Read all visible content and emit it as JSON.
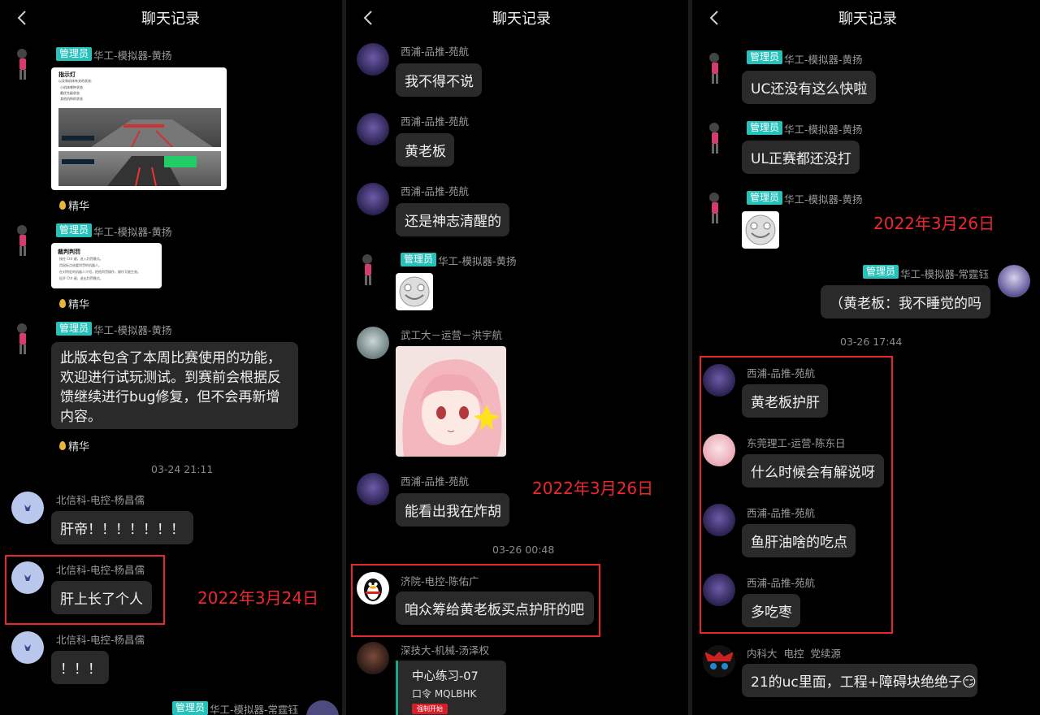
{
  "title": "聊天记录",
  "colors": {
    "admin_tag": "#26c1b9",
    "annotation_red": "#f0262e",
    "bubble": "#2a2a2a"
  },
  "panel1": {
    "m1": {
      "badge": "管理员",
      "name": "华工-模拟器-黄扬",
      "card_title": "指示灯",
      "card_sub": "以及和机体有关的状态:",
      "card_items": [
        "小机体哪种状态",
        "最优先级状态",
        "其他机构的状态"
      ],
      "tag": "精华"
    },
    "m2": {
      "badge": "管理员",
      "name": "华工-模拟器-黄扬",
      "card_title": "裁判判罚",
      "card_items": [
        "按住 Ctrl 键，进入判罚模式。",
        "用鼠标点选要判罚的机器人。",
        "在对特定的机器人介绍，把他判罚操作，操作又能生效。",
        "松开 Ctrl 键，退出判罚模式。"
      ],
      "tag": "精华"
    },
    "m3": {
      "badge": "管理员",
      "name": "华工-模拟器-黄扬",
      "text": "此版本包含了本周比赛使用的功能，欢迎进行试玩测试。到赛前会根据反馈继续进行bug修复，但不会再新增内容。",
      "tag": "精华"
    },
    "ts": "03-24 21:11",
    "m4": {
      "name": "北信科-电控-杨昌儒",
      "text": "肝帝！！！！！！！"
    },
    "m5": {
      "name": "北信科-电控-杨昌儒",
      "text": "肝上长了个人"
    },
    "m6": {
      "name": "北信科-电控-杨昌儒",
      "text": "！！！"
    },
    "m7": {
      "badge": "管理员",
      "name": "华工-模拟器-常霆钰"
    },
    "annotation": "2022年3月24日"
  },
  "panel2": {
    "m1": {
      "name": "西浦-品推-苑航",
      "text": "我不得不说"
    },
    "m2": {
      "name": "西浦-品推-苑航",
      "text": "黄老板"
    },
    "m3": {
      "name": "西浦-品推-苑航",
      "text": "还是神志清醒的"
    },
    "m4": {
      "badge": "管理员",
      "name": "华工-模拟器-黄扬"
    },
    "m5": {
      "name": "武工大－运营－洪宇航"
    },
    "m6": {
      "name": "西浦-品推-苑航",
      "text": "能看出我在炸胡"
    },
    "annotation": "2022年3月26日",
    "ts": "03-26 00:48",
    "m7": {
      "name": "济院-电控-陈佑广",
      "text": "咱众筹给黄老板买点护肝的吧"
    },
    "m8": {
      "name": "深技大-机械-汤泽权",
      "card_title": "中心练习-07",
      "card_code": "口令 MQLBHK",
      "card_btn": "强制开始"
    }
  },
  "panel3": {
    "m1": {
      "badge": "管理员",
      "name": "华工-模拟器-黄扬",
      "text": "UC还没有这么快啦"
    },
    "m2": {
      "badge": "管理员",
      "name": "华工-模拟器-黄扬",
      "text": "UL正赛都还没打"
    },
    "m3": {
      "badge": "管理员",
      "name": "华工-模拟器-黄扬"
    },
    "annotation": "2022年3月26日",
    "m4": {
      "badge": "管理员",
      "name": "华工-模拟器-常霆钰",
      "text": "（黄老板：我不睡觉的吗"
    },
    "ts": "03-26 17:44",
    "m5": {
      "name": "西浦-品推-苑航",
      "text": "黄老板护肝"
    },
    "m6": {
      "name": "东莞理工-运营-陈东日",
      "text": "什么时候会有解说呀"
    },
    "m7": {
      "name": "西浦-品推-苑航",
      "text": "鱼肝油啥的吃点"
    },
    "m8": {
      "name": "西浦-品推-苑航",
      "text": "多吃枣"
    },
    "m9": {
      "name": "内科大  电控  党续源",
      "text": "21的uc里面，工程+障碍块绝绝子😏"
    }
  }
}
